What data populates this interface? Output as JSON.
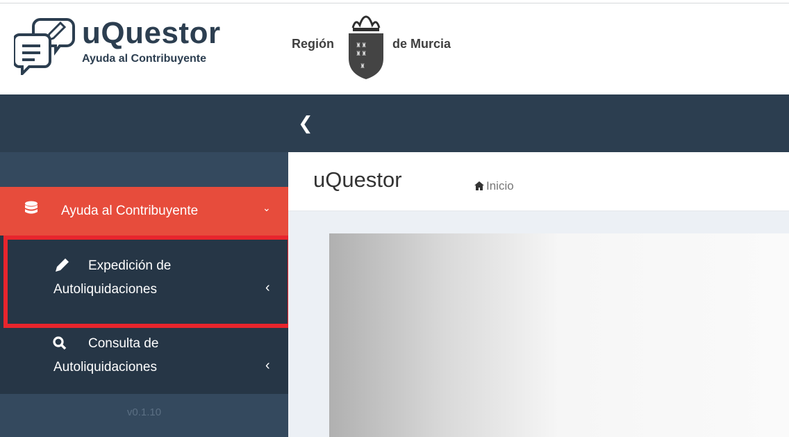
{
  "header": {
    "app_title": "uQuestor",
    "app_subtitle": "Ayuda al Contribuyente",
    "region_left": "Región",
    "region_right": "de Murcia"
  },
  "navbar": {
    "toggle_glyph": "❮"
  },
  "sidebar": {
    "active_item": {
      "label": "Ayuda al Contribuyente",
      "icon": "database-icon",
      "chevron": "⌄"
    },
    "items": [
      {
        "line1": "Expedición de",
        "line2": "Autoliquidaciones",
        "icon": "pencil-icon",
        "chevron": "‹"
      },
      {
        "line1": "Consulta de",
        "line2": "Autoliquidaciones",
        "icon": "search-icon",
        "chevron": "‹"
      }
    ],
    "version": "v0.1.10"
  },
  "content": {
    "title": "uQuestor",
    "breadcrumb": "Inicio"
  },
  "colors": {
    "sidebar_bg": "#2c3e50",
    "active_item_bg": "#e74c3c",
    "highlight_border": "#e8252d",
    "content_bg": "#ecf0f5"
  }
}
